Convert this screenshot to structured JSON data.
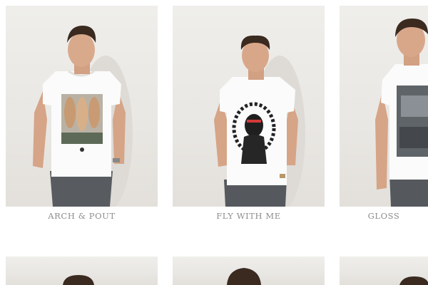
{
  "products": [
    {
      "name": "ARCH & POUT",
      "print": "group-photo-print"
    },
    {
      "name": "FLY WITH ME",
      "print": "bird-woman-print"
    },
    {
      "name": "GLOSS",
      "print": "grey-photo-print"
    },
    {
      "name": "",
      "print": ""
    },
    {
      "name": "",
      "print": ""
    },
    {
      "name": "",
      "print": ""
    }
  ],
  "colors": {
    "background": "#ffffff",
    "photo_bg": "#ebe9e5",
    "label": "#8c8c8c",
    "tshirt": "#fbfbfb",
    "jeans": "#55595d",
    "skin": "#d8a78a",
    "hair": "#3a2a20"
  }
}
